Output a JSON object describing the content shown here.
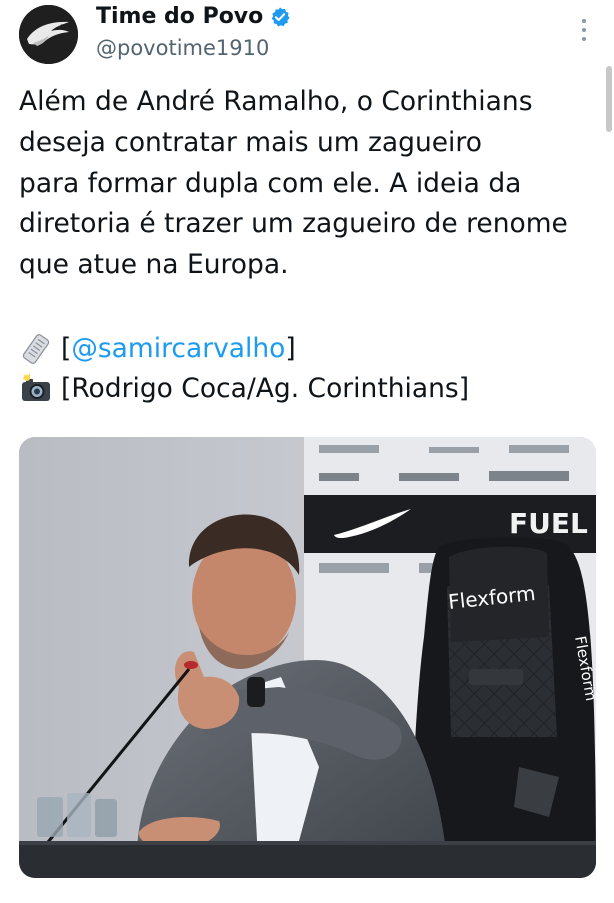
{
  "author": {
    "display_name": "Time do Povo",
    "handle": "@povotime1910",
    "verified_badge_color": "#1d9bf0",
    "avatar_background": "#1f1f1f"
  },
  "tweet": {
    "lines": [
      "Além de André Ramalho, o Corinthians",
      "deseja contratar mais um zagueiro",
      "para formar dupla com ele. A ideia da",
      "diretoria é trazer um zagueiro de renome",
      "que atue na Europa."
    ],
    "source_icon": "newspaper-emoji",
    "source_open": "[",
    "source_mention": "@samircarvalho",
    "source_close": "]",
    "photo_icon": "camera-flash-emoji",
    "photo_credit": "[Rodrigo Coca/Ag. Corinthians]"
  },
  "media": {
    "chair_brand": "Flexform",
    "chair_side_brand": "Flexform",
    "backdrop_sponsor": "FUEL"
  },
  "colors": {
    "link": "#1d9bf0",
    "text": "#0f1419",
    "secondary": "#536471"
  }
}
